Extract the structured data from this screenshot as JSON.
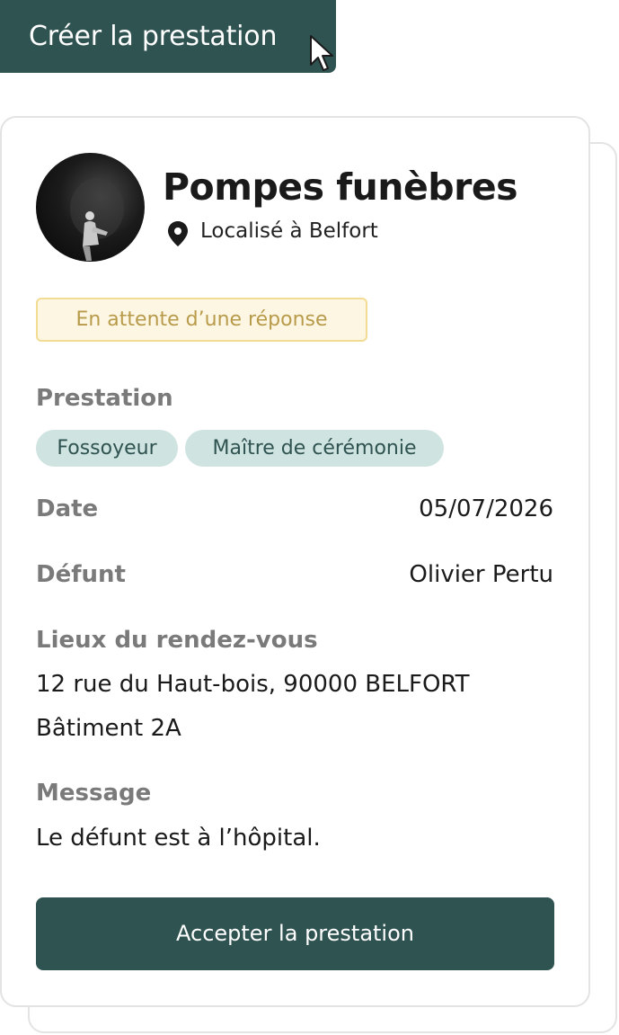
{
  "header": {
    "create_button_label": "Créer la prestation"
  },
  "card": {
    "title": "Pompes funèbres",
    "location": "Localisé à Belfort",
    "status_badge": "En attente d’une réponse",
    "prestation_label": "Prestation",
    "tags": [
      "Fossoyeur",
      "Maître de cérémonie"
    ],
    "date_label": "Date",
    "date_value": "05/07/2026",
    "defunt_label": "Défunt",
    "defunt_value": "Olivier Pertu",
    "lieux_label": "Lieux du rendez-vous",
    "address_line1": "12 rue du Haut-bois, 90000 BELFORT",
    "address_line2": "Bâtiment 2A",
    "message_label": "Message",
    "message_value": "Le défunt est à l’hôpital.",
    "accept_button_label": "Accepter la prestation"
  },
  "icons": {
    "cursor": "mouse-pointer-icon",
    "location": "map-pin-icon"
  },
  "colors": {
    "primary": "#2f5351",
    "tag_bg": "#cfe3e1",
    "status_bg": "#fdf6e3",
    "status_border": "#f2dc94",
    "status_text": "#b89b4a"
  }
}
